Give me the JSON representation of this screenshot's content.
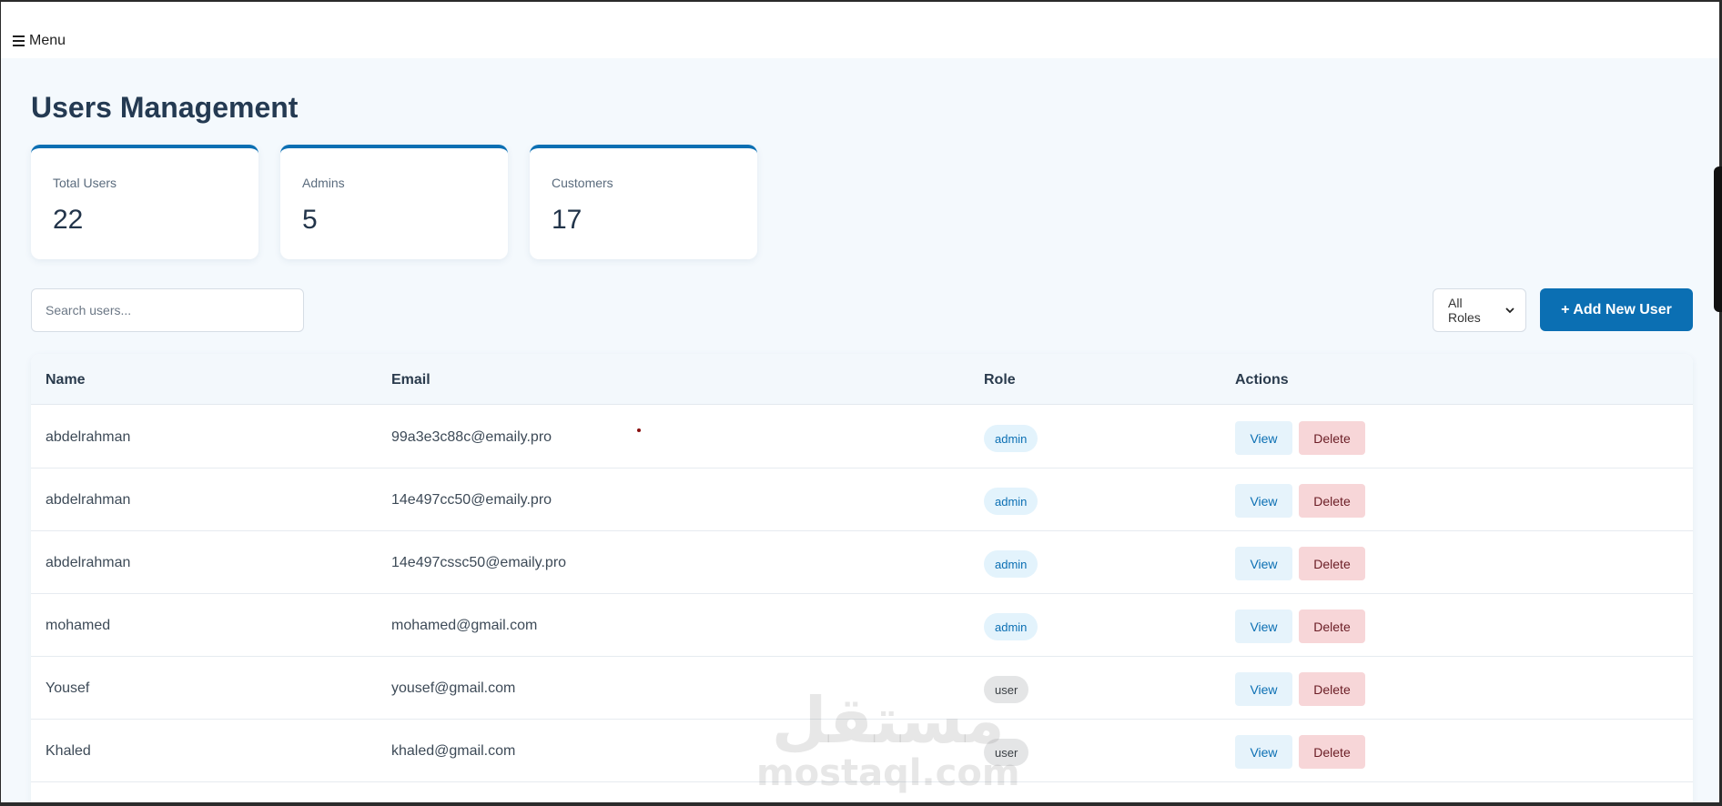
{
  "menu": {
    "label": "Menu"
  },
  "page": {
    "title": "Users Management"
  },
  "stats": [
    {
      "label": "Total Users",
      "value": "22"
    },
    {
      "label": "Admins",
      "value": "5"
    },
    {
      "label": "Customers",
      "value": "17"
    }
  ],
  "toolbar": {
    "search_placeholder": "Search users...",
    "role_filter": "All Roles",
    "add_label": "+ Add New User"
  },
  "table": {
    "columns": [
      "Name",
      "Email",
      "Role",
      "Actions"
    ],
    "rows": [
      {
        "name": "abdelrahman",
        "email": "99a3e3c88c@emaily.pro",
        "role": "admin"
      },
      {
        "name": "abdelrahman",
        "email": "14e497cc50@emaily.pro",
        "role": "admin"
      },
      {
        "name": "abdelrahman",
        "email": "14e497cssc50@emaily.pro",
        "role": "admin"
      },
      {
        "name": "mohamed",
        "email": "mohamed@gmail.com",
        "role": "admin"
      },
      {
        "name": "Yousef",
        "email": "yousef@gmail.com",
        "role": "user"
      },
      {
        "name": "Khaled",
        "email": "khaled@gmail.com",
        "role": "user"
      }
    ],
    "actions": {
      "view": "View",
      "delete": "Delete"
    }
  },
  "watermark": {
    "arabic": "مستقل",
    "latin": "mostaql.com"
  },
  "colors": {
    "accent": "#0b6fb3",
    "background": "#f4f9fd",
    "delete_bg": "#f7d6d8"
  },
  "icons": {
    "menu": "hamburger-icon",
    "select": "chevron-down-icon"
  }
}
